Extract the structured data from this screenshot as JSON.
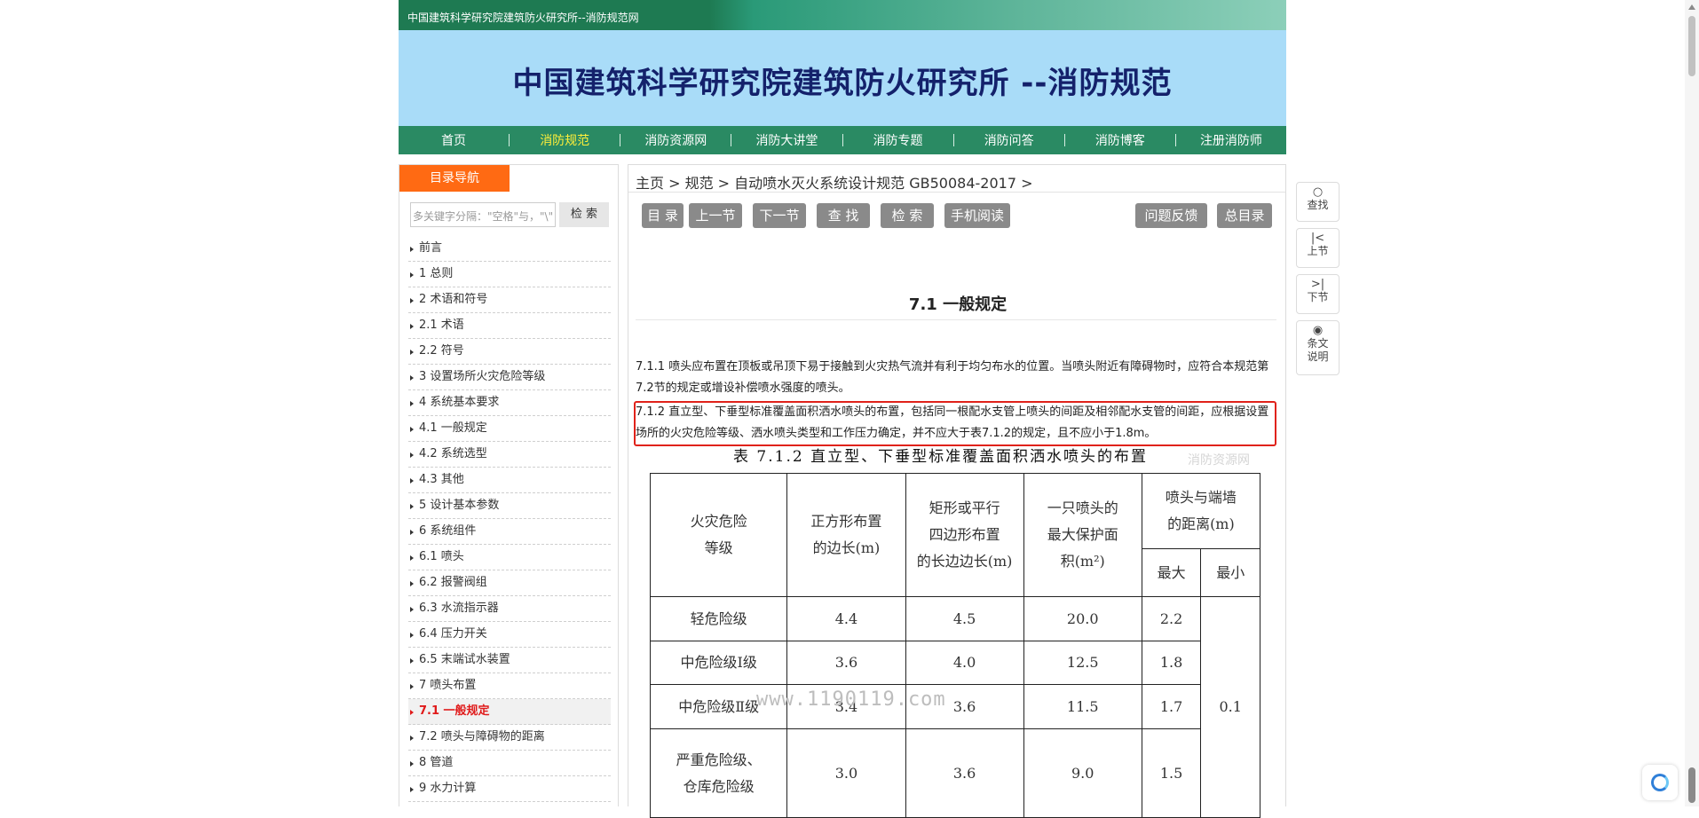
{
  "topbar": {
    "title": "中国建筑科学研究院建筑防火研究所--消防规范网"
  },
  "banner": {
    "site_title": "中国建筑科学研究院建筑防火研究所 --消防规范"
  },
  "nav": {
    "items": [
      "首页",
      "消防规范",
      "消防资源网",
      "消防大讲堂",
      "消防专题",
      "消防问答",
      "消防博客",
      "注册消防师"
    ],
    "active_index": 1
  },
  "sidebar": {
    "tab_label": "目录导航",
    "search_placeholder": "多关键字分隔：\"空格\"与，\"\\\"",
    "search_button": "检 索",
    "items": [
      "前言",
      "1 总则",
      "2 术语和符号",
      "2.1 术语",
      "2.2 符号",
      "3 设置场所火灾危险等级",
      "4 系统基本要求",
      "4.1 一般规定",
      "4.2 系统选型",
      "4.3 其他",
      "5 设计基本参数",
      "6 系统组件",
      "6.1 喷头",
      "6.2 报警阀组",
      "6.3 水流指示器",
      "6.4 压力开关",
      "6.5 末端试水装置",
      "7 喷头布置",
      "7.1 一般规定",
      "7.2 喷头与障碍物的距离",
      "8 管道",
      "9 水力计算"
    ],
    "active_index": 18
  },
  "content": {
    "breadcrumb": "主页 > 规范 > 自动喷水灭火系统设计规范 GB50084-2017 >",
    "toolbar": {
      "catalog": "目 录",
      "prev": "上一节",
      "next": "下一节",
      "find": "查 找",
      "search": "检 索",
      "mobile": "手机阅读",
      "feedback": "问题反馈",
      "all": "总目录"
    },
    "section_title": "7.1 一般规定",
    "para1": "7.1.1 喷头应布置在顶板或吊顶下易于接触到火灾热气流并有利于均匀布水的位置。当喷头附近有障碍物时，应符合本规范第7.2节的规定或增设补偿喷水强度的喷头。",
    "para2": "7.1.2 直立型、下垂型标准覆盖面积洒水喷头的布置，包括同一根配水支管上喷头的间距及相邻配水支管的间距，应根据设置场所的火灾危险等级、洒水喷头类型和工作压力确定，并不应大于表7.1.2的规定，且不应小于1.8m。",
    "watermark_text": "消防资源网",
    "table_caption": "表 7.1.2   直立型、下垂型标准覆盖面积洒水喷头的布置",
    "table": {
      "headers": {
        "hazard": "火灾危险\n等级",
        "square": "正方形布置\n的边长(m)",
        "rect": "矩形或平行\n四边形布置\n的长边边长(m)",
        "area": "一只喷头的\n最大保护面\n积(m²)",
        "wall": "喷头与端墙\n的距离(m)",
        "max": "最大",
        "min": "最小"
      },
      "rows": [
        {
          "hazard": "轻危险级",
          "square": "4.4",
          "rect": "4.5",
          "area": "20.0",
          "max": "2.2"
        },
        {
          "hazard": "中危险级Ⅰ级",
          "square": "3.6",
          "rect": "4.0",
          "area": "12.5",
          "max": "1.8"
        },
        {
          "hazard": "中危险级Ⅱ级",
          "square": "3.4",
          "rect": "3.6",
          "area": "11.5",
          "max": "1.7"
        },
        {
          "hazard": "严重危险级、\n仓库危险级",
          "square": "3.0",
          "rect": "3.6",
          "area": "9.0",
          "max": "1.5"
        }
      ],
      "min_value": "0.1"
    },
    "watermark_url": "www.1190119.com"
  },
  "tools": {
    "find": "查找",
    "prev": "上节",
    "next": "下节",
    "explain": "条文\n说明"
  }
}
